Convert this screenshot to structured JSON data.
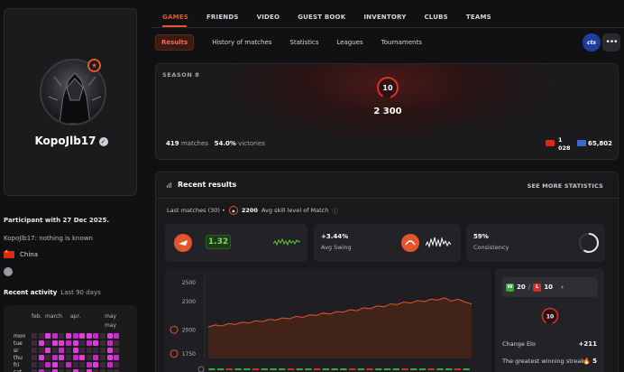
{
  "nav": {
    "items": [
      "GAMES",
      "FRIENDS",
      "VIDEO",
      "GUEST BOOK",
      "INVENTORY",
      "CLUBS",
      "TEAMS"
    ],
    "active": "GAMES"
  },
  "subtabs": {
    "items": [
      "Results",
      "History of matches",
      "Statistics",
      "Leagues",
      "Tournaments"
    ],
    "active": "Results",
    "org_badge": "cts",
    "more": "•••"
  },
  "profile": {
    "nickname": "KopoJlb17",
    "participant": "Participant with 27 Dec 2025.",
    "about": "KopoJlb17: nothing is known",
    "country": "China"
  },
  "activity": {
    "title": "Recent activity",
    "period": "Last 90 days",
    "months": [
      "feb.",
      "march",
      "apr.",
      "may",
      "may"
    ],
    "days": [
      "mon",
      "tue",
      "sr",
      "thu",
      "fri",
      "sat"
    ]
  },
  "season": {
    "label": "SEASON 8",
    "level": "10",
    "elo": "2 300",
    "matches_count": "419",
    "matches_label": "matches",
    "victories_pct": "54.0%",
    "victories_label": "victories",
    "country_rank_line1": "1",
    "country_rank_line2": "028",
    "world_rank": "65,802"
  },
  "results": {
    "title": "Recent results",
    "see_more": "SEE MORE STATISTICS",
    "last_matches_prefix": "Last matches (30) •",
    "avg_skill_level": "2200",
    "avg_skill_label": "Avg skill level of Match",
    "kd": "1.32",
    "avg_swing_value": "+3.44%",
    "avg_swing_label": "Avg Swing",
    "consistency_value": "59%",
    "consistency_label": "Consistency",
    "wins": "20",
    "losses": "10",
    "slash": "/",
    "wl_arrow": "›",
    "elo_card_level": "10",
    "change_elo_label": "Change Elo",
    "change_elo_value": "+211",
    "streak_label": "The greatest winning streak",
    "streak_value": "5"
  },
  "chart_data": {
    "type": "area",
    "y_ticks": [
      "2500",
      "2300",
      "2000",
      "1750"
    ],
    "ylabel": "",
    "values": [
      2030,
      2050,
      2040,
      2065,
      2055,
      2080,
      2070,
      2095,
      2085,
      2110,
      2100,
      2125,
      2115,
      2140,
      2130,
      2155,
      2150,
      2175,
      2165,
      2190,
      2185,
      2210,
      2200,
      2230,
      2220,
      2250,
      2240,
      2270,
      2265,
      2290,
      2280,
      2305,
      2295,
      2320,
      2310,
      2335,
      2300,
      2320,
      2290,
      2270
    ],
    "ylim": [
      1700,
      2550
    ],
    "results_strip": [
      "W",
      "W",
      "L",
      "W",
      "W",
      "L",
      "W",
      "W",
      "W",
      "L",
      "W",
      "W",
      "L",
      "W",
      "W",
      "W",
      "L",
      "W",
      "L",
      "W",
      "W",
      "W",
      "L",
      "W",
      "W",
      "L",
      "W",
      "W",
      "L",
      "W"
    ],
    "colors": {
      "line": "#e2562d",
      "win": "#3aa83a",
      "loss": "#d0302a"
    }
  }
}
